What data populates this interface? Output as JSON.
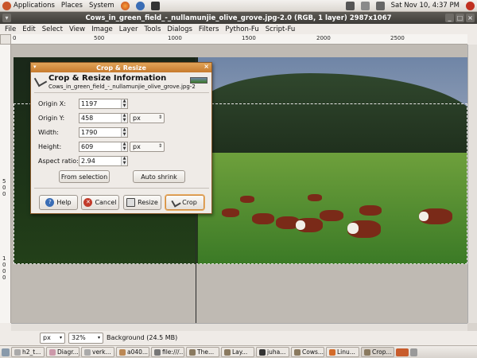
{
  "top_panel": {
    "applications": "Applications",
    "places": "Places",
    "system": "System",
    "clock": "Sat Nov 10,  4:37 PM"
  },
  "window": {
    "title": "Cows_in_green_field_-_nullamunjie_olive_grove.jpg-2.0 (RGB, 1 layer) 2987x1067"
  },
  "menubar": [
    "File",
    "Edit",
    "Select",
    "View",
    "Image",
    "Layer",
    "Tools",
    "Dialogs",
    "Filters",
    "Python-Fu",
    "Script-Fu"
  ],
  "ruler": {
    "top": [
      "0",
      "500",
      "1000",
      "1500",
      "2000",
      "2500"
    ],
    "left": [
      "5",
      "0",
      "0",
      "1",
      "0",
      "0",
      "0"
    ]
  },
  "dialog": {
    "window_title": "Crop & Resize",
    "heading": "Crop & Resize Information",
    "subheading": "Cows_in_green_field_-_nullamunjie_olive_grove.jpg-2",
    "fields": {
      "origin_x_label": "Origin X:",
      "origin_x_value": "1197",
      "origin_y_label": "Origin Y:",
      "origin_y_value": "458",
      "width_label": "Width:",
      "width_value": "1790",
      "height_label": "Height:",
      "height_value": "609",
      "aspect_label": "Aspect ratio:",
      "aspect_value": "2.94",
      "unit_y": "px",
      "unit_h": "px"
    },
    "buttons": {
      "from_selection": "From selection",
      "auto_shrink": "Auto shrink",
      "help": "Help",
      "cancel": "Cancel",
      "resize": "Resize",
      "crop": "Crop"
    }
  },
  "statusbar": {
    "unit": "px",
    "zoom": "32%",
    "layer_info": "Background (24.5 MB)"
  },
  "taskbar": [
    "h2_t...",
    "Diagr...",
    "verk...",
    "a040...",
    "file:///...",
    "The...",
    "Lay...",
    "juha...",
    "Cows...",
    "Linu...",
    "Crop..."
  ],
  "colors": {
    "accent": "#d0883a",
    "titlebar": "#4a4743"
  }
}
